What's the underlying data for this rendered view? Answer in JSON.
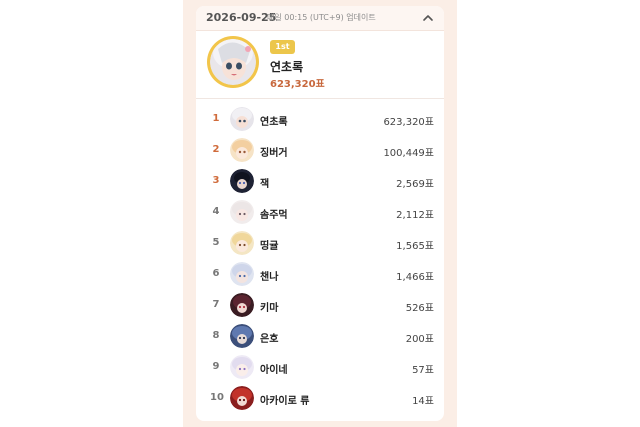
{
  "header": {
    "date": "2026-09-25",
    "update_note": "매일 00:15 (UTC+9) 업데이트",
    "collapse_icon": "chevron-up-icon"
  },
  "top": {
    "badge": "1st",
    "name": "연초록",
    "votes": "623,320표",
    "ring_color": "#f2c54a",
    "votes_color": "#c8683d"
  },
  "ranking": [
    {
      "rank": "1",
      "name": "연초록",
      "votes": "623,320표"
    },
    {
      "rank": "2",
      "name": "징버거",
      "votes": "100,449표"
    },
    {
      "rank": "3",
      "name": "잭",
      "votes": "2,569표"
    },
    {
      "rank": "4",
      "name": "솜주먹",
      "votes": "2,112표"
    },
    {
      "rank": "5",
      "name": "띵귤",
      "votes": "1,565표"
    },
    {
      "rank": "6",
      "name": "챈나",
      "votes": "1,466표"
    },
    {
      "rank": "7",
      "name": "키마",
      "votes": "526표"
    },
    {
      "rank": "8",
      "name": "은호",
      "votes": "200표"
    },
    {
      "rank": "9",
      "name": "아이네",
      "votes": "57표"
    },
    {
      "rank": "10",
      "name": "아카이로 류",
      "votes": "14표"
    }
  ],
  "colors": {
    "panel_bg": "#fbeee6",
    "top3_rank": "#d06b3b"
  }
}
